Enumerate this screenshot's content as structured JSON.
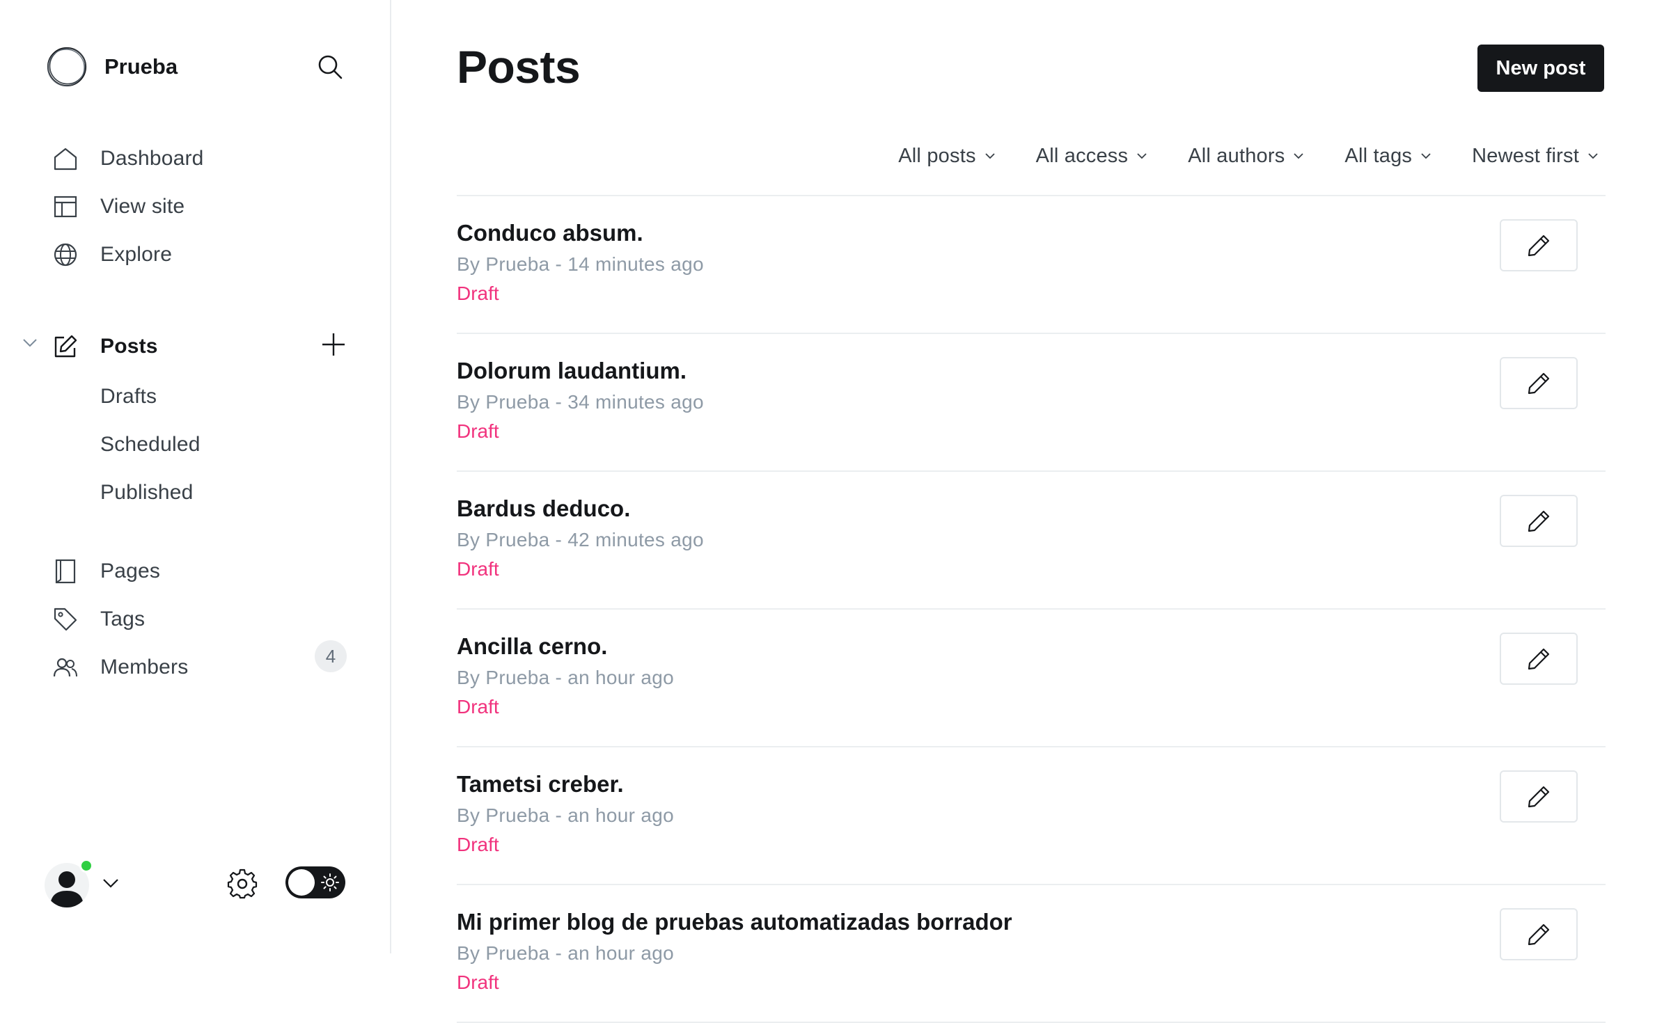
{
  "app": {
    "site_name": "Prueba",
    "logo_icon": "site-logo-ring",
    "search_icon": "search-icon"
  },
  "sidebar": {
    "nav": [
      {
        "label": "Dashboard",
        "icon": "home-icon"
      },
      {
        "label": "View site",
        "icon": "layout-icon"
      },
      {
        "label": "Explore",
        "icon": "globe-icon"
      }
    ],
    "posts": {
      "label": "Posts",
      "icon": "edit-square-icon",
      "expanded": true,
      "sub_items": [
        {
          "label": "Drafts"
        },
        {
          "label": "Scheduled"
        },
        {
          "label": "Published"
        }
      ]
    },
    "nav2": [
      {
        "label": "Pages",
        "icon": "page-icon"
      },
      {
        "label": "Tags",
        "icon": "tag-icon"
      },
      {
        "label": "Members",
        "icon": "members-icon",
        "badge": "4"
      }
    ],
    "footer": {
      "avatar_icon": "user-avatar",
      "status_color": "#30cf43",
      "settings_icon": "gear-icon",
      "theme_toggle": {
        "state": "dark",
        "icon": "sun-icon"
      }
    }
  },
  "main": {
    "title": "Posts",
    "new_post_label": "New post",
    "filters": [
      {
        "label": "All posts"
      },
      {
        "label": "All access"
      },
      {
        "label": "All authors"
      },
      {
        "label": "All tags"
      },
      {
        "label": "Newest first"
      }
    ],
    "posts": [
      {
        "title": "Conduco absum.",
        "meta": "By Prueba - 14 minutes ago",
        "status": "Draft"
      },
      {
        "title": "Dolorum laudantium.",
        "meta": "By Prueba - 34 minutes ago",
        "status": "Draft"
      },
      {
        "title": "Bardus deduco.",
        "meta": "By Prueba - 42 minutes ago",
        "status": "Draft"
      },
      {
        "title": "Ancilla cerno.",
        "meta": "By Prueba - an hour ago",
        "status": "Draft"
      },
      {
        "title": "Tametsi creber.",
        "meta": "By Prueba - an hour ago",
        "status": "Draft"
      },
      {
        "title": "Mi primer blog de pruebas automatizadas borrador",
        "meta": "By Prueba - an hour ago",
        "status": "Draft"
      }
    ]
  },
  "colors": {
    "accent_draft": "#f1327d",
    "primary_button": "#15171a",
    "meta_text": "#8e9aa6"
  }
}
